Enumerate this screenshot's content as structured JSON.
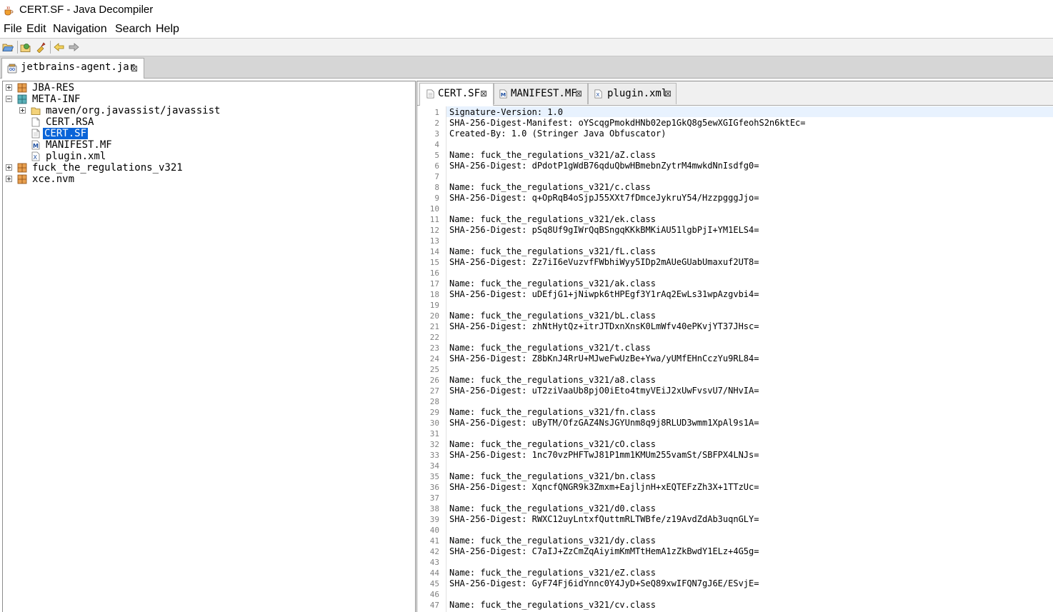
{
  "window": {
    "title": "CERT.SF - Java Decompiler"
  },
  "menu": [
    "File",
    "Edit",
    "Navigation",
    "Search",
    "Help"
  ],
  "toolbar": {
    "icons": [
      "open-file-icon",
      "open-type-icon",
      "search-icon",
      "back-icon",
      "forward-icon"
    ]
  },
  "jar_tab": {
    "label": "jetbrains-agent.jar",
    "close": "⊠"
  },
  "tree": [
    {
      "label": "JBA-RES",
      "expander": "plus",
      "icon": "package-icon"
    },
    {
      "label": "META-INF",
      "expander": "minus",
      "icon": "package-icon"
    },
    {
      "label": "maven/org.javassist/javassist",
      "expander": "plus",
      "icon": "folder-icon"
    },
    {
      "label": "CERT.RSA",
      "expander": "",
      "icon": "file-icon"
    },
    {
      "label": "CERT.SF",
      "expander": "",
      "icon": "file-icon",
      "selected": true
    },
    {
      "label": "MANIFEST.MF",
      "expander": "",
      "icon": "manifest-icon"
    },
    {
      "label": "plugin.xml",
      "expander": "",
      "icon": "xml-icon"
    },
    {
      "label": "fuck_the_regulations_v321",
      "expander": "plus",
      "icon": "package-icon"
    },
    {
      "label": "xce.nvm",
      "expander": "plus",
      "icon": "package-icon"
    }
  ],
  "editor_tabs": [
    {
      "label": "CERT.SF",
      "active": true,
      "icon": "file-icon",
      "close": "⊠"
    },
    {
      "label": "MANIFEST.MF",
      "active": false,
      "icon": "manifest-icon",
      "close": "⊠"
    },
    {
      "label": "plugin.xml",
      "active": false,
      "icon": "xml-icon",
      "close": "⊠"
    }
  ],
  "code_lines": [
    "Signature-Version: 1.0",
    "SHA-256-Digest-Manifest: oYScqgPmokdHNb02ep1GkQ8g5ewXGIGfeohS2n6ktEc=",
    "Created-By: 1.0 (Stringer Java Obfuscator)",
    "",
    "Name: fuck_the_regulations_v321/aZ.class",
    "SHA-256-Digest: dPdotP1gWdB76qduQbwHBmebnZytrM4mwkdNnIsdfg0=",
    "",
    "Name: fuck_the_regulations_v321/c.class",
    "SHA-256-Digest: q+OpRqB4oSjpJ55XXt7fDmceJykruY54/HzzpgggJjo=",
    "",
    "Name: fuck_the_regulations_v321/ek.class",
    "SHA-256-Digest: pSq8Uf9gIWrQqBSngqKKkBMKiAU51lgbPjI+YM1ELS4=",
    "",
    "Name: fuck_the_regulations_v321/fL.class",
    "SHA-256-Digest: Zz7iI6eVuzvfFWbhiWyy5IDp2mAUeGUabUmaxuf2UT8=",
    "",
    "Name: fuck_the_regulations_v321/ak.class",
    "SHA-256-Digest: uDEfjG1+jNiwpk6tHPEgf3Y1rAq2EwLs31wpAzgvbi4=",
    "",
    "Name: fuck_the_regulations_v321/bL.class",
    "SHA-256-Digest: zhNtHytQz+itrJTDxnXnsK0LmWfv40ePKvjYT37JHsc=",
    "",
    "Name: fuck_the_regulations_v321/t.class",
    "SHA-256-Digest: Z8bKnJ4RrU+MJweFwUzBe+Ywa/yUMfEHnCczYu9RL84=",
    "",
    "Name: fuck_the_regulations_v321/a8.class",
    "SHA-256-Digest: uT2ziVaaUb8pjO0iEto4tmyVEiJ2xUwFvsvU7/NHvIA=",
    "",
    "Name: fuck_the_regulations_v321/fn.class",
    "SHA-256-Digest: uByTM/OfzGAZ4NsJGYUnm8q9j8RLUD3wmm1XpAl9s1A=",
    "",
    "Name: fuck_the_regulations_v321/cO.class",
    "SHA-256-Digest: 1nc70vzPHFTwJ81P1mm1KMUm255vamSt/SBFPX4LNJs=",
    "",
    "Name: fuck_the_regulations_v321/bn.class",
    "SHA-256-Digest: XqncfQNGR9k3Zmxm+EajljnH+xEQTEFzZh3X+1TTzUc=",
    "",
    "Name: fuck_the_regulations_v321/d0.class",
    "SHA-256-Digest: RWXC12uyLntxfQuttmRLTWBfe/z19AvdZdAb3uqnGLY=",
    "",
    "Name: fuck_the_regulations_v321/dy.class",
    "SHA-256-Digest: C7aIJ+ZzCmZqAiyimKmMTtHemA1zZkBwdY1ELz+4G5g=",
    "",
    "Name: fuck_the_regulations_v321/eZ.class",
    "SHA-256-Digest: GyF74Fj6idYnnc0Y4JyD+SeQ89xwIFQN7gJ6E/ESvjE=",
    "",
    "Name: fuck_the_regulations_v321/cv.class"
  ],
  "colors": {
    "selection": "#0a64d8",
    "package": "#c8762a",
    "folder": "#e8c268"
  }
}
